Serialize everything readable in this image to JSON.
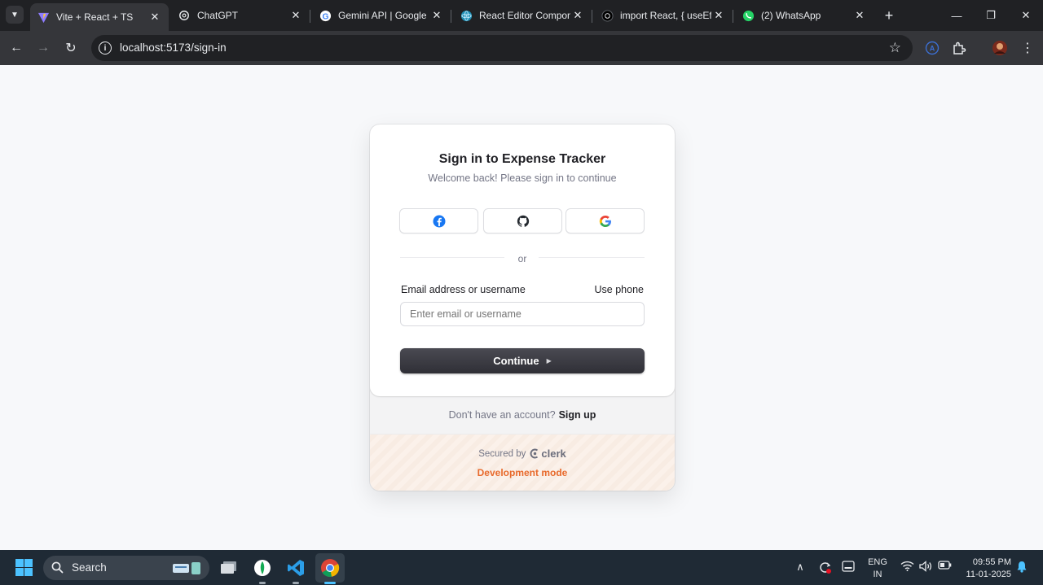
{
  "browser": {
    "tabs": [
      {
        "title": "Vite + React + TS",
        "active": true,
        "icon": "vite-icon"
      },
      {
        "title": "ChatGPT",
        "active": false,
        "icon": "chatgpt-icon"
      },
      {
        "title": "Gemini API  |  Google",
        "active": false,
        "icon": "google-icon"
      },
      {
        "title": "React Editor Compone",
        "active": false,
        "icon": "react-icon"
      },
      {
        "title": "import React, { useEff",
        "active": false,
        "icon": "dark-circle-icon"
      },
      {
        "title": "(2) WhatsApp",
        "active": false,
        "icon": "whatsapp-icon"
      }
    ],
    "url": "localhost:5173/sign-in"
  },
  "signin": {
    "title": "Sign in to Expense Tracker",
    "subtitle": "Welcome back! Please sign in to continue",
    "social_providers": [
      "facebook",
      "github",
      "google"
    ],
    "divider": "or",
    "email_label": "Email address or username",
    "use_phone": "Use phone",
    "email_placeholder": "Enter email or username",
    "email_value": "",
    "continue_label": "Continue",
    "no_account": "Don't have an account?",
    "signup_label": "Sign up",
    "secured_by": "Secured by",
    "clerk_brand": "clerk",
    "dev_mode": "Development mode"
  },
  "taskbar": {
    "search_label": "Search",
    "lang_line1": "ENG",
    "lang_line2": "IN",
    "time": "09:55 PM",
    "date": "11-01-2025"
  },
  "colors": {
    "accent_dev": "#e86a2c",
    "button_dark": "#2f2f36",
    "win_accent": "#4cc2ff"
  }
}
